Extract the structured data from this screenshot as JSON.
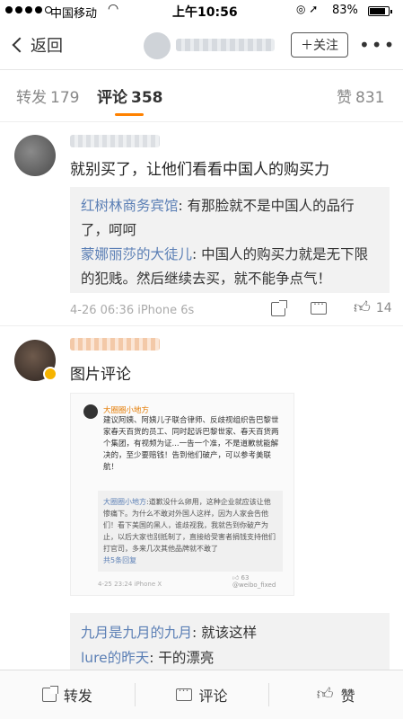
{
  "status_bar": {
    "carrier": "中国移动",
    "time": "上午10:56",
    "battery": "83%",
    "battery_level": 0.83
  },
  "nav": {
    "back_label": "返回",
    "follow_label": "＋关注",
    "more_label": "•••"
  },
  "tabs": [
    {
      "label": "转发",
      "count": "179"
    },
    {
      "label": "评论",
      "count": "358"
    },
    {
      "label": "赞",
      "count": "831"
    }
  ],
  "comments": [
    {
      "text": "就别买了，让他们看看中国人的购买力",
      "replies": [
        {
          "name": "红树林商务宾馆",
          "text": ": 有那脸就不是中国人的品行了，呵呵"
        },
        {
          "name": "蒙娜丽莎的大徒儿",
          "text": ": 中国人的购买力就是无下限的犯贱。然后继续去买，就不能争点气！"
        }
      ],
      "meta": "4-26 06:36 iPhone 6s",
      "likes": "14"
    },
    {
      "text": "图片评论",
      "image": {
        "name": "大圈圈小地方",
        "post": "建议阿姨、阿姨儿子联合律师、反歧视组织告巴黎世家春天百货的员工、同时起诉巴黎世家、春天百货两个集团，有视频为证...一告一个准，不是道歉就能解决的，至少要赔钱！告到他们破产，可以参考美联航！",
        "sub_name": "大圈圈小地方",
        "sub_text": ":道歉没什么卵用，这种企业就应该让他惨痛下。为什么不敢对外国人这样，因为人家会告他们！看下美国的黑人，谁歧视我，我就告到你破产为止，以后大家也别抵制了，直接给受害者捐钱支持他们打官司，多来几次其他品牌就不敢了",
        "more": "共5条回复",
        "footer": "4-25 23:24 iPhone X",
        "likes": "63",
        "watermark": "@weibo_fixed"
      },
      "replies": [
        {
          "name": "九月是九月的九月",
          "text": ": 就该这样"
        },
        {
          "name": "lure的昨天",
          "text": ": 干的漂亮"
        }
      ]
    }
  ],
  "toolbar": [
    {
      "label": "转发",
      "icon": "share-icon"
    },
    {
      "label": "评论",
      "icon": "comment-icon"
    },
    {
      "label": "赞",
      "icon": "like-icon"
    }
  ]
}
